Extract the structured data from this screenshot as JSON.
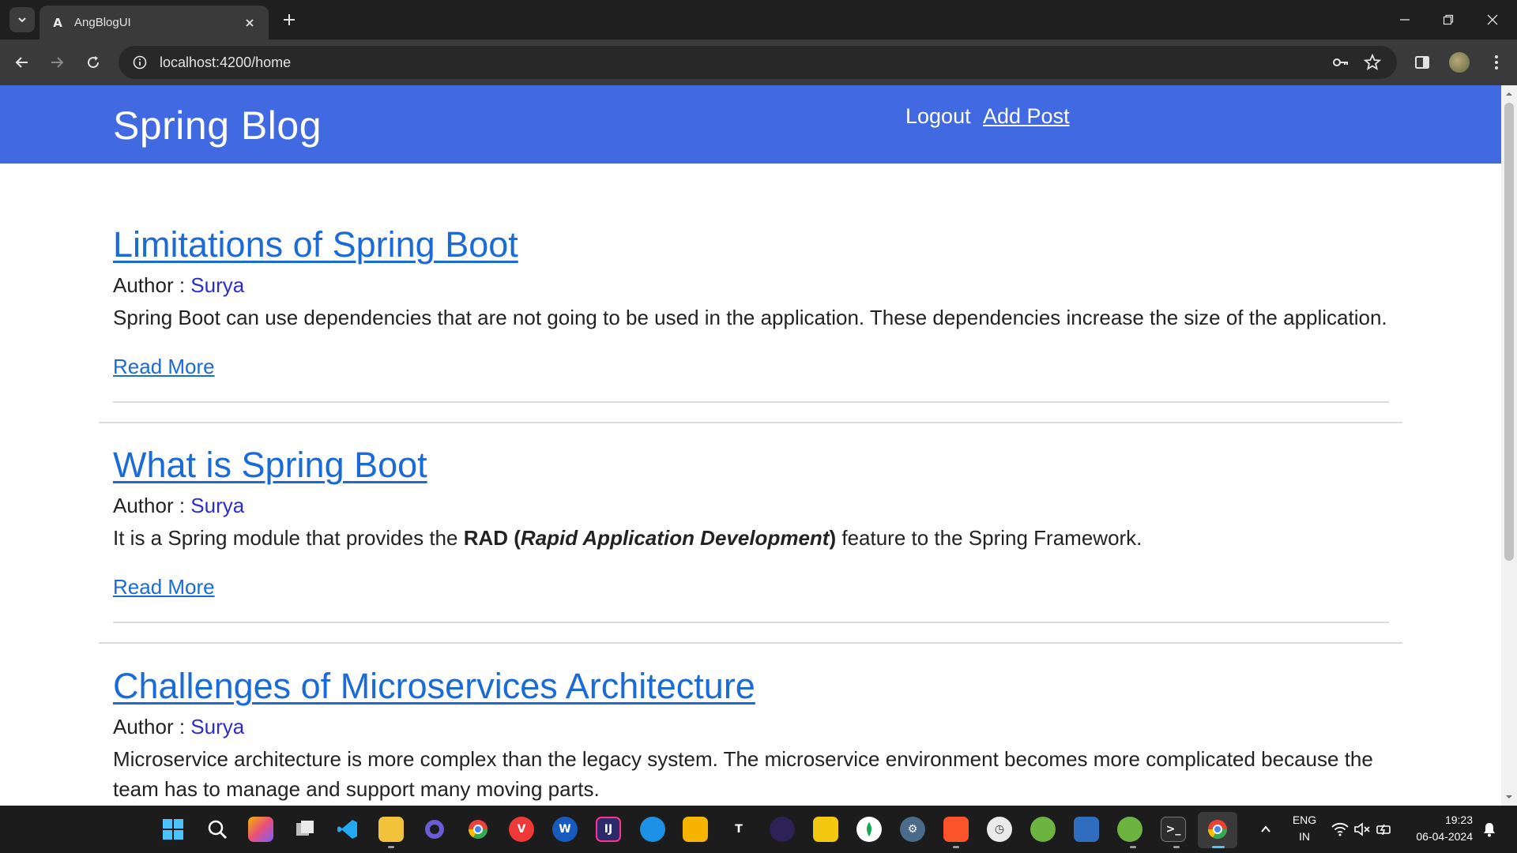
{
  "browser": {
    "tab_title": "AngBlogUI",
    "url": "localhost:4200/home"
  },
  "header": {
    "brand": "Spring Blog",
    "nav": {
      "logout": "Logout",
      "add_post": "Add Post"
    },
    "background_color": "#4169e1"
  },
  "posts": [
    {
      "title": "Limitations of Spring Boot",
      "author_label": "Author : ",
      "author": "Surya",
      "content": "Spring Boot can use dependencies that are not going to be used in the application. These dependencies increase the size of the application.",
      "read_more": "Read More"
    },
    {
      "title": "What is Spring Boot",
      "author_label": "Author : ",
      "author": "Surya",
      "content_parts": {
        "before": "It is a Spring module that provides the ",
        "bold": "RAD (",
        "bold_italic": "Rapid Application Development",
        "bold_close": ")",
        "after": " feature to the Spring Framework."
      },
      "read_more": "Read More"
    },
    {
      "title": "Challenges of Microservices Architecture",
      "author_label": "Author : ",
      "author": "Surya",
      "content": "Microservice architecture is more complex than the legacy system. The microservice environment becomes more complicated because the team has to manage and support many moving parts."
    }
  ],
  "taskbar": {
    "apps": [
      "windows-start-icon",
      "search-icon",
      "copilot-icon",
      "task-view-icon",
      "vscode-icon",
      "file-explorer-icon",
      "obs-icon",
      "chrome-icon",
      "vivaldi-icon",
      "word-icon",
      "intellij-icon",
      "docker-icon",
      "keep-icon",
      "typora-icon",
      "eclipse-icon",
      "power-bi-icon",
      "mongodb-compass-icon",
      "settings-icon",
      "brave-icon",
      "clock-icon",
      "spring-tools-icon",
      "remote-desktop-icon",
      "spring-boot-icon",
      "terminal-icon",
      "chrome-active-icon"
    ],
    "language": "ENG",
    "region": "IN",
    "time": "19:23",
    "date": "06-04-2024"
  }
}
